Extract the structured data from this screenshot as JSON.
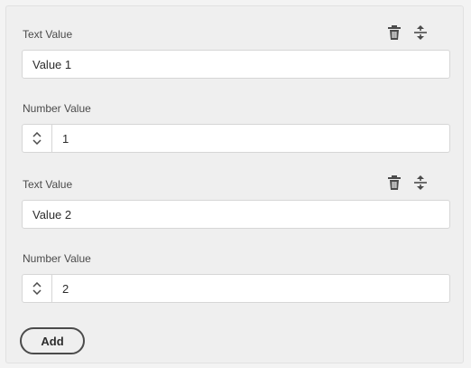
{
  "items": [
    {
      "text_label": "Text Value",
      "text_value": "Value 1",
      "number_label": "Number Value",
      "number_value": "1"
    },
    {
      "text_label": "Text Value",
      "text_value": "Value 2",
      "number_label": "Number Value",
      "number_value": "2"
    }
  ],
  "add_label": "Add",
  "icons": {
    "delete": "trash-icon",
    "reorder": "move-vertical-icon",
    "stepper": "chevron-up-down-icon"
  },
  "colors": {
    "panel_bg": "#efefef",
    "field_border": "#d6d6d6",
    "icon": "#4b4b4b",
    "text": "#2c2c2c"
  }
}
